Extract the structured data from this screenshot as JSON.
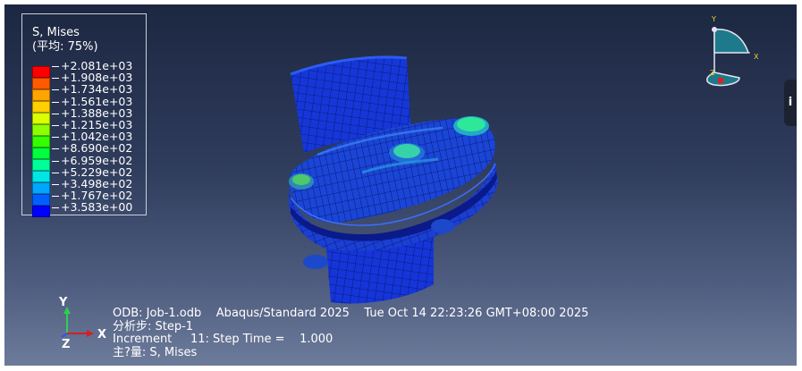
{
  "legend": {
    "title": "S, Mises",
    "subtitle": "(平均: 75%)",
    "colors": [
      "#ff0000",
      "#ff5a00",
      "#ffa500",
      "#ffcf00",
      "#d9ff00",
      "#8cff00",
      "#34ff00",
      "#00ff3c",
      "#00ff9a",
      "#00e5e5",
      "#00a6ff",
      "#0060ff",
      "#0000ff"
    ],
    "values": [
      "+2.081e+03",
      "+1.908e+03",
      "+1.734e+03",
      "+1.561e+03",
      "+1.388e+03",
      "+1.215e+03",
      "+1.042e+03",
      "+8.690e+02",
      "+6.959e+02",
      "+5.229e+02",
      "+3.498e+02",
      "+1.767e+02",
      "+3.583e+00"
    ]
  },
  "info": {
    "line1": "ODB: Job-1.odb    Abaqus/Standard 2025    Tue Oct 14 22:23:26 GMT+08:00 2025",
    "line2": "分析步: Step-1",
    "line3": "Increment     11: Step Time =    1.000",
    "line4": "主?量: S, Mises"
  },
  "axis": {
    "y_label": "Y",
    "x_label": "X",
    "z_label": "Z",
    "y_color": "#2bd24a",
    "x_color": "#d42020",
    "z_color": "#3050ff"
  },
  "triad": {
    "y_label": "Y",
    "x_label": "X",
    "z_label": "Z"
  },
  "side_tab": {
    "label": "i"
  },
  "colors": {
    "mesh_blue": "#1535d8",
    "mesh_dark": "#0a1c9c",
    "mesh_light": "#2a6ad0"
  }
}
